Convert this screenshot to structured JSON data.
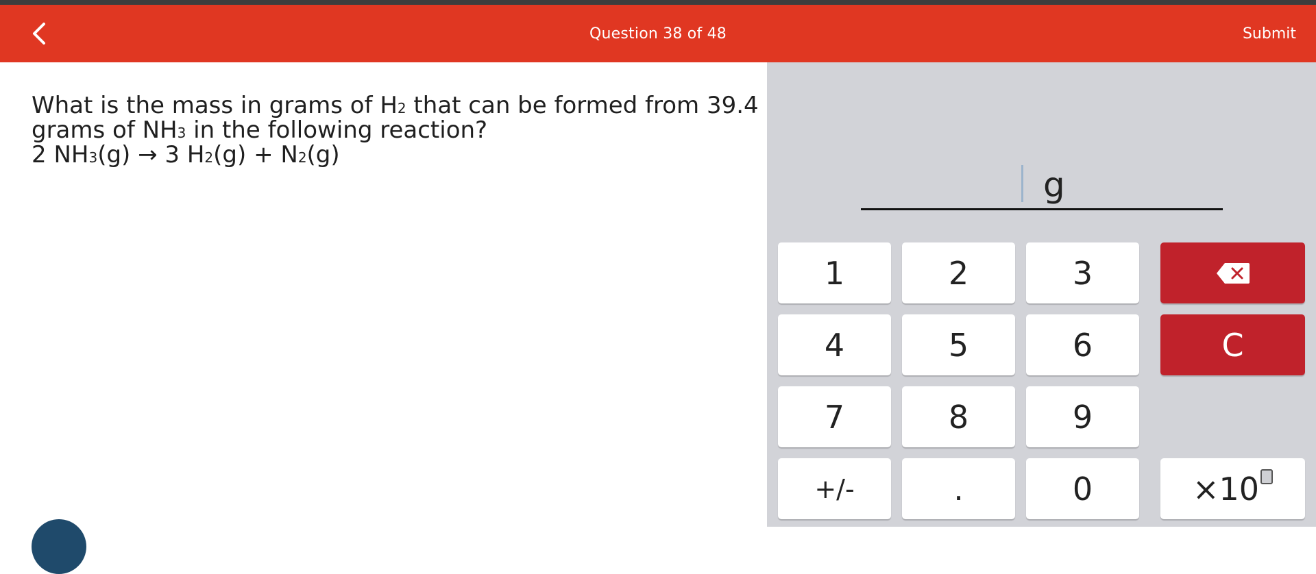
{
  "header": {
    "title": "Question 38 of 48",
    "submit_label": "Submit"
  },
  "question": {
    "line1_a": "What is the mass in grams of H",
    "line1_sub": "2",
    "line1_b": " that can be formed from 39.4",
    "line2_a": "grams of NH",
    "line2_sub": "3",
    "line2_b": " in the following reaction?",
    "eq_a": "2 NH",
    "eq_sub1": "3",
    "eq_b": "(g) → 3 H",
    "eq_sub2": "2",
    "eq_c": "(g) + N",
    "eq_sub3": "2",
    "eq_d": "(g)"
  },
  "answer": {
    "value": "",
    "unit": "g"
  },
  "keypad": {
    "k1": "1",
    "k2": "2",
    "k3": "3",
    "k4": "4",
    "k5": "5",
    "k6": "6",
    "k7": "7",
    "k8": "8",
    "k9": "9",
    "sign": "+/-",
    "dot": ".",
    "k0": "0",
    "clear": "C",
    "exp": "×10"
  },
  "colors": {
    "header": "#e03722",
    "accent_key": "#c0222b",
    "panel": "#d2d3d8"
  },
  "icons": {
    "back": "chevron-left-icon",
    "backspace": "backspace-icon"
  }
}
